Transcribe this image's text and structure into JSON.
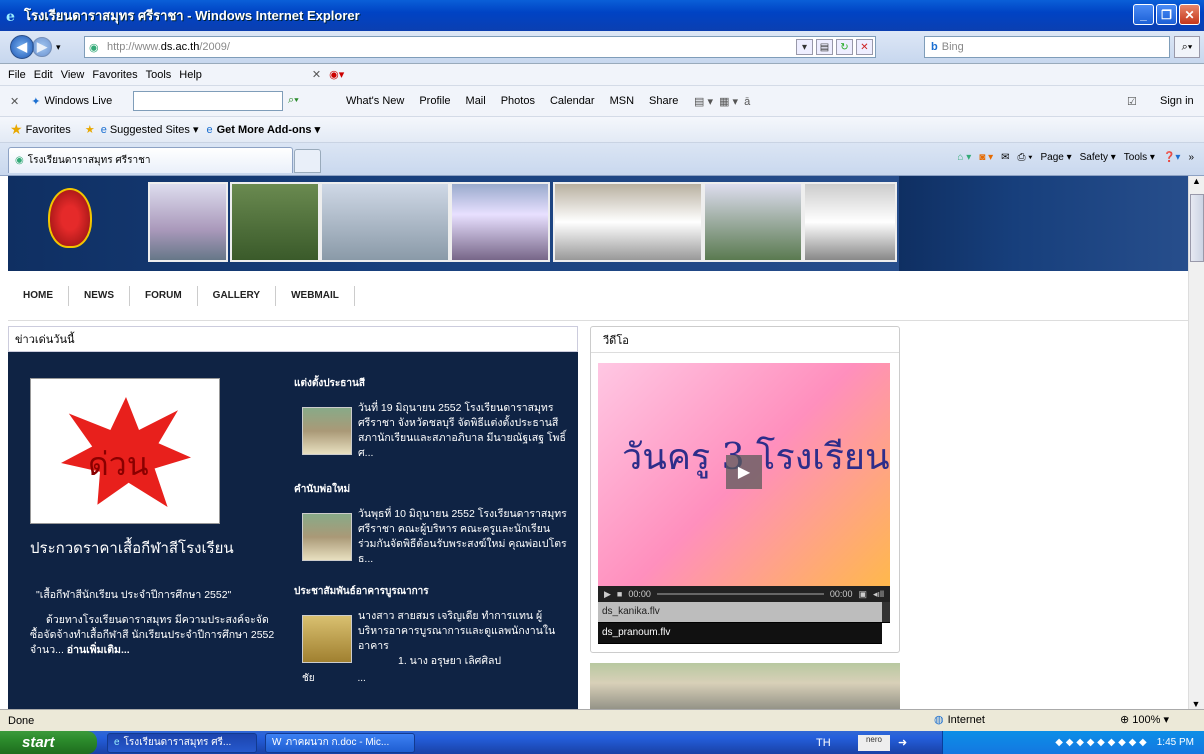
{
  "window": {
    "title": "โรงเรียนดาราสมุทร ศรีราชา - Windows Internet Explorer"
  },
  "address": {
    "url_prefix": "http://www.",
    "url_domain": "ds.ac.th",
    "url_suffix": "/2009/"
  },
  "search": {
    "placeholder": "Bing"
  },
  "menu": {
    "items": [
      "File",
      "Edit",
      "View",
      "Favorites",
      "Tools",
      "Help"
    ]
  },
  "windows_live": {
    "label": "Windows Live",
    "links": [
      "What's New",
      "Profile",
      "Mail",
      "Photos",
      "Calendar",
      "MSN",
      "Share"
    ],
    "signin": "Sign in"
  },
  "favorites": {
    "label": "Favorites",
    "suggested": "Suggested Sites ▾",
    "addons": "Get More Add-ons ▾"
  },
  "tab": {
    "title": "โรงเรียนดาราสมุทร ศรีราชา"
  },
  "commands": {
    "page": "Page ▾",
    "safety": "Safety ▾",
    "tools": "Tools ▾"
  },
  "site": {
    "nav": [
      "HOME",
      "NEWS",
      "FORUM",
      "GALLERY",
      "WEBMAIL"
    ],
    "news_heading": "ข่าวเด่นวันนี้",
    "hot_image_text": "ด่วน",
    "hot_title": "ประกวดราคาเสื้อกีฬาสีโรงเรียน",
    "hot_quote": "\"เสื้อกีฬาสีนักเรียน ประจำปีการศึกษา 2552\"",
    "hot_body": "ด้วยทางโรงเรียนดาราสมุทร มีความประสงค์จะจัดซื้อจัดจ้างทำเสื้อกีฬาสี นักเรียนประจำปีการศึกษา 2552 จำนว...",
    "hot_more": "อ่านเพิ่มเติม...",
    "news": [
      {
        "title": "แต่งตั้งประธานสี",
        "text": "วันที่ 19 มิถุนายน 2552 โรงเรียนดาราสมุทร ศรีราชา จังหวัดชลบุรี จัดพิธีแต่งตั้งประธานสี สภานักเรียนและสภาอภิบาล มีนายณัฐเสฐ โพธิ์ศ..."
      },
      {
        "title": "คำนับพ่อใหม่",
        "text": "วันพุธที่ 10 มิถุนายน 2552 โรงเรียนดาราสมุทร ศรีราชา คณะผู้บริหาร คณะครูและนักเรียน ร่วมกันจัดพิธีต้อนรับพระสงฆ์ใหม่ คุณพ่อเปโตร ธ..."
      },
      {
        "title": "ประชาสัมพันธ์อาคารบูรณาการ",
        "text": "นางสาว สายสมร เจริญเดีย ทำการแทน ผู้บริหารอาคารบูรณาการและดูแลพนักงานในอาคาร",
        "extra": "1. นาง อรุษยา เลิศศิลป",
        "extra2": "ชัย"
      }
    ],
    "video_heading": "วีดีโอ",
    "video_overlay": "วันครู 3 โรงเรียน",
    "time_current": "00:00",
    "time_total": "00:00",
    "playlist": [
      "ds_kanika.flv",
      "ds_pranoum.flv"
    ]
  },
  "status": {
    "text": "Done",
    "zone": "Internet",
    "zoom": "100%"
  },
  "taskbar": {
    "start": "start",
    "tasks": [
      "โรงเรียนดาราสมุทร ศรี...",
      "ภาคผนวก ก.doc - Mic..."
    ],
    "lang": "TH",
    "time": "1:45 PM"
  }
}
